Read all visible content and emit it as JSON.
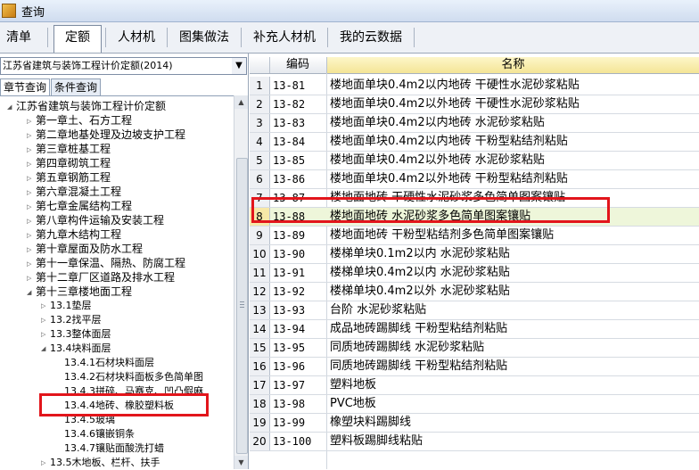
{
  "window": {
    "title": "查询"
  },
  "tabs": [
    {
      "label": "清单"
    },
    {
      "label": "定额"
    },
    {
      "label": "人材机"
    },
    {
      "label": "图集做法"
    },
    {
      "label": "补充人材机"
    },
    {
      "label": "我的云数据"
    }
  ],
  "left": {
    "dropdown": {
      "value": "江苏省建筑与装饰工程计价定额(2014)"
    },
    "subtabs": [
      {
        "label": "章节查询"
      },
      {
        "label": "条件查询"
      }
    ],
    "tree": [
      {
        "label": "江苏省建筑与装饰工程计价定额",
        "toggle": "◢"
      },
      {
        "label": "第一章土、石方工程",
        "toggle": "▷"
      },
      {
        "label": "第二章地基处理及边坡支护工程",
        "toggle": "▷"
      },
      {
        "label": "第三章桩基工程",
        "toggle": "▷"
      },
      {
        "label": "第四章砌筑工程",
        "toggle": "▷"
      },
      {
        "label": "第五章钢筋工程",
        "toggle": "▷"
      },
      {
        "label": "第六章混凝土工程",
        "toggle": "▷"
      },
      {
        "label": "第七章金属结构工程",
        "toggle": "▷"
      },
      {
        "label": "第八章构件运输及安装工程",
        "toggle": "▷"
      },
      {
        "label": "第九章木结构工程",
        "toggle": "▷"
      },
      {
        "label": "第十章屋面及防水工程",
        "toggle": "▷"
      },
      {
        "label": "第十一章保温、隔热、防腐工程",
        "toggle": "▷"
      },
      {
        "label": "第十二章厂区道路及排水工程",
        "toggle": "▷"
      },
      {
        "label": "第十三章楼地面工程",
        "toggle": "◢"
      },
      {
        "label": "13.1垫层",
        "toggle": "▷"
      },
      {
        "label": "13.2找平层",
        "toggle": "▷"
      },
      {
        "label": "13.3整体面层",
        "toggle": "▷"
      },
      {
        "label": "13.4块料面层",
        "toggle": "◢"
      },
      {
        "label": "13.4.1石材块料面层",
        "toggle": ""
      },
      {
        "label": "13.4.2石材块料面板多色简单图",
        "toggle": ""
      },
      {
        "label": "13.4.3拼碎、马赛克、凹凸假麻",
        "toggle": ""
      },
      {
        "label": "13.4.4地砖、橡胶塑料板",
        "toggle": ""
      },
      {
        "label": "13.4.5玻璃",
        "toggle": ""
      },
      {
        "label": "13.4.6镶嵌铜条",
        "toggle": ""
      },
      {
        "label": "13.4.7镶贴面酸洗打蜡",
        "toggle": ""
      },
      {
        "label": "13.5木地板、栏杆、扶手",
        "toggle": "▷"
      }
    ]
  },
  "grid": {
    "headers": {
      "num": "",
      "code": "编码",
      "name": "名称"
    },
    "rows": [
      {
        "num": "1",
        "code": "13-81",
        "name": "楼地面单块0.4m2以内地砖 干硬性水泥砂浆粘贴"
      },
      {
        "num": "2",
        "code": "13-82",
        "name": "楼地面单块0.4m2以外地砖 干硬性水泥砂浆粘贴"
      },
      {
        "num": "3",
        "code": "13-83",
        "name": "楼地面单块0.4m2以内地砖 水泥砂浆粘贴"
      },
      {
        "num": "4",
        "code": "13-84",
        "name": "楼地面单块0.4m2以内地砖 干粉型粘结剂粘贴"
      },
      {
        "num": "5",
        "code": "13-85",
        "name": "楼地面单块0.4m2以外地砖 水泥砂浆粘贴"
      },
      {
        "num": "6",
        "code": "13-86",
        "name": "楼地面单块0.4m2以外地砖 干粉型粘结剂粘贴"
      },
      {
        "num": "7",
        "code": "13-87",
        "name": "楼地面地砖 干硬性水泥砂浆多色简单图案镶贴"
      },
      {
        "num": "8",
        "code": "13-88",
        "name": "楼地面地砖 水泥砂浆多色简单图案镶贴"
      },
      {
        "num": "9",
        "code": "13-89",
        "name": "楼地面地砖 干粉型粘结剂多色简单图案镶贴"
      },
      {
        "num": "10",
        "code": "13-90",
        "name": "楼梯单块0.1m2以内 水泥砂浆粘贴"
      },
      {
        "num": "11",
        "code": "13-91",
        "name": "楼梯单块0.4m2以内 水泥砂浆粘贴"
      },
      {
        "num": "12",
        "code": "13-92",
        "name": "楼梯单块0.4m2以外 水泥砂浆粘贴"
      },
      {
        "num": "13",
        "code": "13-93",
        "name": "台阶 水泥砂浆粘贴"
      },
      {
        "num": "14",
        "code": "13-94",
        "name": "成品地砖踢脚线 干粉型粘结剂粘贴"
      },
      {
        "num": "15",
        "code": "13-95",
        "name": "同质地砖踢脚线 水泥砂浆粘贴"
      },
      {
        "num": "16",
        "code": "13-96",
        "name": "同质地砖踢脚线 干粉型粘结剂粘贴"
      },
      {
        "num": "17",
        "code": "13-97",
        "name": "塑料地板"
      },
      {
        "num": "18",
        "code": "13-98",
        "name": "PVC地板"
      },
      {
        "num": "19",
        "code": "13-99",
        "name": "橡塑块料踢脚线"
      },
      {
        "num": "20",
        "code": "13-100",
        "name": "塑料板踢脚线粘贴"
      }
    ]
  }
}
